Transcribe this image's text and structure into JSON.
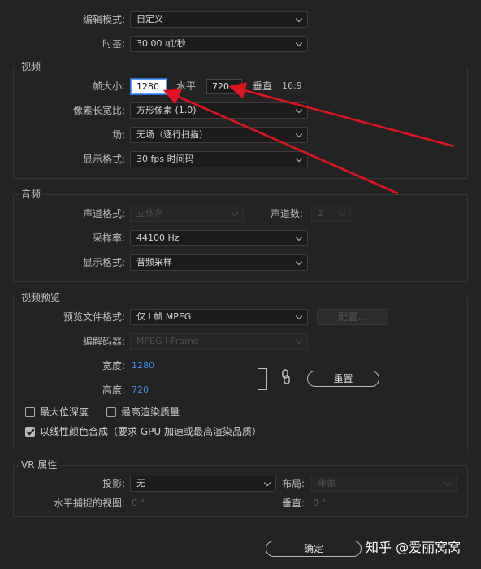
{
  "top": {
    "editing_mode_label": "编辑模式:",
    "editing_mode_value": "自定义",
    "timebase_label": "时基:",
    "timebase_value": "30.00  帧/秒"
  },
  "video": {
    "title": "视频",
    "frame_size_label": "帧大小:",
    "frame_width": "1280",
    "horizontal_label": "水平",
    "frame_height": "720",
    "vertical_label": "垂直",
    "aspect_ratio": "16:9",
    "pixel_aspect_label": "像素长宽比:",
    "pixel_aspect_value": "方形像素 (1.0)",
    "fields_label": "场:",
    "fields_value": "无场（逐行扫描）",
    "display_format_label": "显示格式:",
    "display_format_value": "30 fps 时间码"
  },
  "audio": {
    "title": "音频",
    "channel_format_label": "声道格式:",
    "channel_format_value": "立体声",
    "channel_count_label": "声道数:",
    "channel_count_value": "2",
    "sample_rate_label": "采样率:",
    "sample_rate_value": "44100 Hz",
    "display_format_label": "显示格式:",
    "display_format_value": "音频采样"
  },
  "preview": {
    "title": "视频预览",
    "file_format_label": "预览文件格式:",
    "file_format_value": "仅 I 帧 MPEG",
    "config_button": "配置...",
    "codec_label": "编解码器:",
    "codec_value": "MPEG I-Frame",
    "width_label": "宽度:",
    "width_value": "1280",
    "height_label": "高度:",
    "height_value": "720",
    "reset_button": "重置",
    "max_bit_depth": "最大位深度",
    "max_render_quality": "最高渲染质量",
    "linear_color": "以线性颜色合成（要求 GPU 加速或最高渲染品质）"
  },
  "vr": {
    "title": "VR 属性",
    "projection_label": "投影:",
    "projection_value": "无",
    "layout_label": "布局:",
    "layout_value": "单像",
    "h_view_label": "水平捕捉的视图:",
    "h_view_value": "0 °",
    "v_label": "垂直:",
    "v_value": "0 °"
  },
  "footer": {
    "ok_button": "确定",
    "watermark": "知乎 @爱丽窝窝"
  },
  "colors": {
    "annotation_arrow": "#e0141e",
    "accent_blue": "#3f8fe8"
  }
}
